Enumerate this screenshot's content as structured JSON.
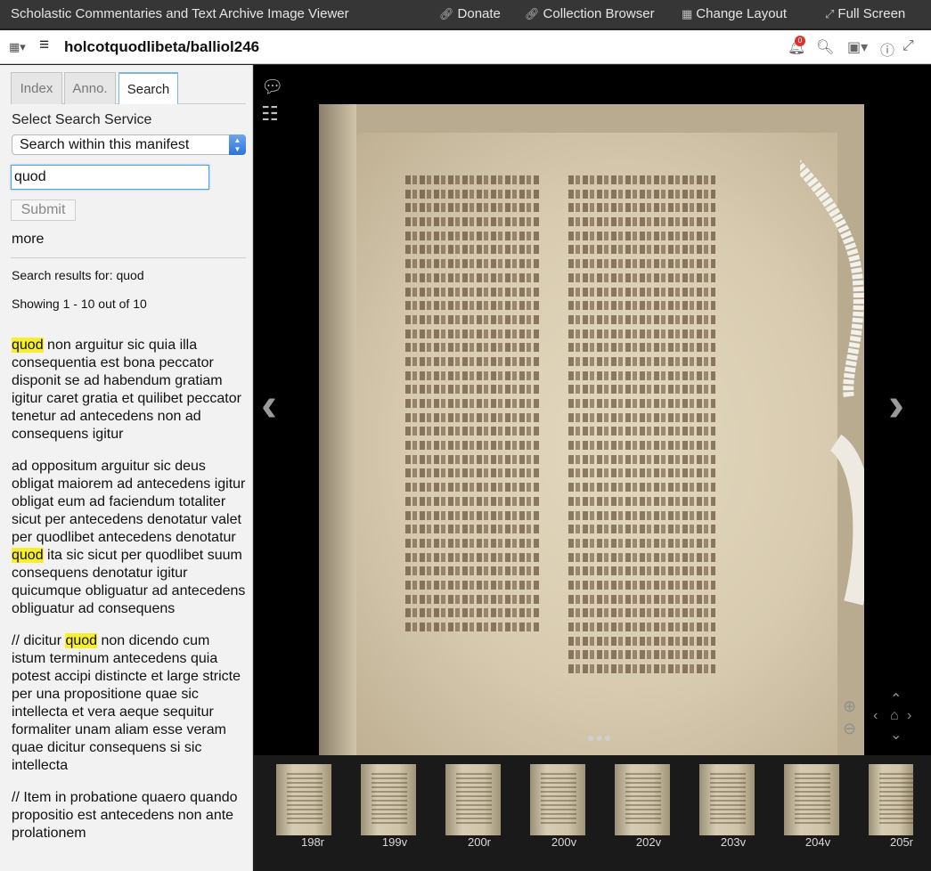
{
  "topbar": {
    "title": "Scholastic Commentaries and Text Archive Image Viewer",
    "donate": "Donate",
    "collection_browser": "Collection Browser",
    "change_layout": "Change Layout",
    "full_screen": "Full Screen"
  },
  "window": {
    "title": "holcotquodlibeta/balliol246",
    "notification_count": "0"
  },
  "sidebar": {
    "tabs": [
      "Index",
      "Anno.",
      "Search"
    ],
    "select_label": "Select Search Service",
    "select_value": "Search within this manifest",
    "query": "quod",
    "submit": "Submit",
    "more": "more",
    "results_for": "Search results for: quod",
    "showing": "Showing 1 - 10 out of 10"
  },
  "results": [
    {
      "before": "",
      "hit": "quod",
      "after": " non arguitur sic quia illa consequentia est bona peccator disponit se ad habendum gratiam igitur caret gratia et quilibet peccator tenetur ad antecedens non ad consequens igitur"
    },
    {
      "before": "ad oppositum arguitur sic deus obligat maiorem ad antecedens igitur obligat eum ad faciendum totaliter sicut per antecedens denotatur valet per quodlibet antecedens denotatur ",
      "hit": "quod",
      "after": " ita sic sicut per quodlibet suum consequens denotatur igitur quicumque obliguatur ad antecedens obliguatur ad consequens"
    },
    {
      "before": "// dicitur ",
      "hit": "quod",
      "after": " non dicendo cum istum terminum antecedens quia potest accipi distincte et large stricte per una propositione quae sic intellecta et vera aeque sequitur formaliter unam aliam esse veram quae dicitur consequens si sic intellecta"
    },
    {
      "before": "// Item in probatione quaero quando propositio est antecedens non ante prolationem",
      "hit": "",
      "after": ""
    }
  ],
  "thumbnails": [
    "198r",
    "199v",
    "200r",
    "200v",
    "202v",
    "203v",
    "204v",
    "205r"
  ],
  "icons": {
    "donate": "link-icon",
    "collection": "link-icon",
    "layout": "grid-icon",
    "fullscreen": "expand-icon"
  }
}
